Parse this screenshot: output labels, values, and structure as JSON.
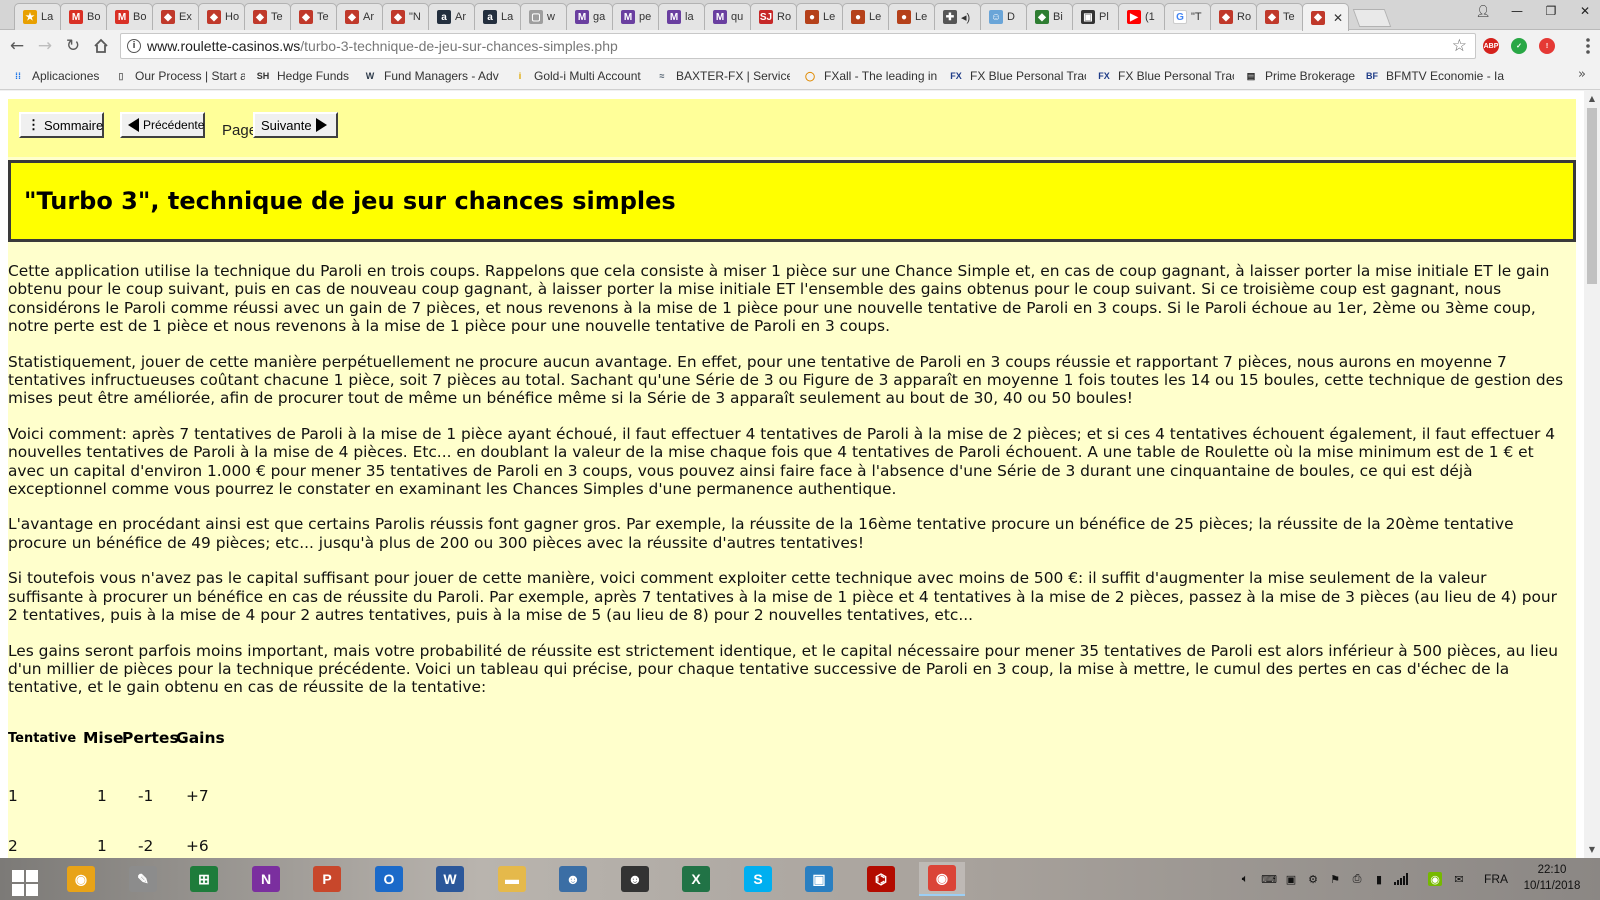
{
  "browser": {
    "tabs": [
      {
        "label": "La",
        "favicon_color": "#e8a000",
        "glyph": "★"
      },
      {
        "label": "Bo",
        "favicon_color": "#d93025",
        "glyph": "M"
      },
      {
        "label": "Bo",
        "favicon_color": "#d93025",
        "glyph": "M"
      },
      {
        "label": "Ex",
        "favicon_color": "#c0392b",
        "glyph": "◆"
      },
      {
        "label": "Ho",
        "favicon_color": "#c0392b",
        "glyph": "◆"
      },
      {
        "label": "Te",
        "favicon_color": "#c0392b",
        "glyph": "◆"
      },
      {
        "label": "Te",
        "favicon_color": "#c0392b",
        "glyph": "◆"
      },
      {
        "label": "Ar",
        "favicon_color": "#c0392b",
        "glyph": "◆"
      },
      {
        "label": "\"N",
        "favicon_color": "#c0392b",
        "glyph": "◆"
      },
      {
        "label": "Ar",
        "favicon_color": "#232f3e",
        "glyph": "a"
      },
      {
        "label": "La",
        "favicon_color": "#232f3e",
        "glyph": "a"
      },
      {
        "label": "w",
        "favicon_color": "#9e9e9e",
        "glyph": "▢"
      },
      {
        "label": "ga",
        "favicon_color": "#6a3fa0",
        "glyph": "M"
      },
      {
        "label": "pe",
        "favicon_color": "#6a3fa0",
        "glyph": "M"
      },
      {
        "label": "la",
        "favicon_color": "#6a3fa0",
        "glyph": "M"
      },
      {
        "label": "qu",
        "favicon_color": "#6a3fa0",
        "glyph": "M"
      },
      {
        "label": "Ro",
        "favicon_color": "#c62828",
        "glyph": "SJ"
      },
      {
        "label": "Le",
        "favicon_color": "#b5411a",
        "glyph": "●"
      },
      {
        "label": "Le",
        "favicon_color": "#b5411a",
        "glyph": "●"
      },
      {
        "label": "Le",
        "favicon_color": "#b5411a",
        "glyph": "●"
      },
      {
        "label": "◂)",
        "favicon_color": "#555555",
        "glyph": "✚"
      },
      {
        "label": "D",
        "favicon_color": "#6aa5d8",
        "glyph": "☺"
      },
      {
        "label": "Bi",
        "favicon_color": "#2e7d32",
        "glyph": "◆"
      },
      {
        "label": "Pl",
        "favicon_color": "#333333",
        "glyph": "▣"
      },
      {
        "label": "(1",
        "favicon_color": "#ff0000",
        "glyph": "▶"
      },
      {
        "label": "\"T",
        "favicon_color": "#ffffff",
        "glyph": "G"
      },
      {
        "label": "Ro",
        "favicon_color": "#c0392b",
        "glyph": "◆"
      },
      {
        "label": "Te",
        "favicon_color": "#c0392b",
        "glyph": "◆"
      },
      {
        "label": "",
        "favicon_color": "#c0392b",
        "glyph": "◆",
        "active": true
      }
    ],
    "url_domain": "www.roulette-casinos.ws",
    "url_path": "/turbo-3-technique-de-jeu-sur-chances-simples.php",
    "bookmarks": [
      {
        "label": "Aplicaciones",
        "icon": "apps-grid"
      },
      {
        "label": "Our Process | Start a",
        "icon": "page"
      },
      {
        "label": "Hedge Funds",
        "icon": "SH"
      },
      {
        "label": "Fund Managers - Adv",
        "icon": "W"
      },
      {
        "label": "Gold-i Multi Account",
        "icon": "i"
      },
      {
        "label": "BAXTER-FX | Services",
        "icon": "wave"
      },
      {
        "label": "FXall - The leading in",
        "icon": "circle"
      },
      {
        "label": "FX Blue Personal Trac",
        "icon": "FX"
      },
      {
        "label": "FX Blue Personal Trac",
        "icon": "FX"
      },
      {
        "label": "Prime Brokerage",
        "icon": "keyboard"
      },
      {
        "label": "BFMTV Economie - Ia",
        "icon": "BF"
      }
    ],
    "extensions": [
      {
        "name": "adblock-plus",
        "label": "ABP",
        "color": "#d5221d"
      },
      {
        "name": "check-extension",
        "label": "✓",
        "color": "#29a745"
      },
      {
        "name": "alert-extension",
        "label": "!",
        "color": "#e53935"
      }
    ]
  },
  "page": {
    "nav": {
      "sommaire": "Sommaire",
      "precedente": "Précédente",
      "page_word": "Page",
      "suivante": "Suivante"
    },
    "title": "\"Turbo 3\", technique de jeu sur chances simples",
    "paragraphs": [
      "Cette application utilise la technique du Paroli en trois coups. Rappelons que cela consiste à miser 1 pièce sur une Chance Simple et, en cas de coup gagnant, à laisser porter la mise initiale ET le gain obtenu pour le coup suivant, puis en cas de nouveau coup gagnant, à laisser porter la mise initiale ET l'ensemble des gains obtenus pour le coup suivant. Si ce troisième coup est gagnant, nous considérons le Paroli comme réussi avec un gain de 7 pièces, et nous revenons à la mise de 1 pièce pour une nouvelle tentative de Paroli en 3 coups. Si le Paroli échoue au 1er, 2ème ou 3ème coup, notre perte est de 1 pièce et nous revenons à la mise de 1 pièce pour une nouvelle tentative de Paroli en 3 coups.",
      "Statistiquement, jouer de cette manière perpétuellement ne procure aucun avantage. En effet, pour une tentative de Paroli en 3 coups réussie et rapportant 7 pièces, nous aurons en moyenne 7 tentatives infructueuses coûtant chacune 1 pièce, soit 7 pièces au total. Sachant qu'une Série de 3 ou Figure de 3 apparaît en moyenne 1 fois toutes les 14 ou 15 boules, cette technique de gestion des mises peut être améliorée, afin de procurer tout de même un bénéfice même si la Série de 3 apparaît seulement au bout de 30, 40 ou 50 boules!",
      "Voici comment: après 7 tentatives de Paroli à la mise de 1 pièce ayant échoué, il faut effectuer 4 tentatives de Paroli à la mise de 2 pièces; et si ces 4 tentatives échouent également, il faut effectuer 4 nouvelles tentatives de Paroli à la mise de 4 pièces. Etc... en doublant la valeur de la mise chaque fois que 4 tentatives de Paroli échouent. A une table de Roulette où la mise minimum est de 1 € et avec un capital d'environ 1.000 € pour mener 35 tentatives de Paroli en 3 coups, vous pouvez ainsi faire face à l'absence d'une Série de 3 durant une cinquantaine de boules, ce qui est déjà exceptionnel comme vous pourrez le constater en examinant les Chances Simples d'une permanence authentique.",
      "L'avantage en procédant ainsi est que certains Parolis réussis font gagner gros. Par exemple, la réussite de la 16ème tentative procure un bénéfice de 25 pièces; la réussite de la 20ème tentative procure un bénéfice de 49 pièces; etc... jusqu'à plus de 200 ou 300 pièces avec la réussite d'autres tentatives!",
      "Si toutefois vous n'avez pas le capital suffisant pour jouer de cette manière, voici comment exploiter cette technique avec moins de 500 €: il suffit d'augmenter la mise seulement de la valeur suffisante à procurer un bénéfice en cas de réussite du Paroli. Par exemple, après 7 tentatives à la mise de 1 pièce et 4 tentatives à la mise de 2 pièces, passez à la mise de 3 pièces (au lieu de 4) pour 2 tentatives, puis à la mise de 4 pour 2 autres tentatives, puis à la mise de 5 (au lieu de 8) pour 2 nouvelles tentatives, etc...",
      "Les gains seront parfois moins important, mais votre probabilité de réussite est strictement identique, et le capital nécessaire pour mener 35 tentatives de Paroli est alors inférieur à 500 pièces, au lieu d'un millier de pièces pour la technique précédente. Voici un tableau qui précise, pour chaque tentative successive de Paroli en 3 coup, la mise à mettre, le cumul des pertes en cas d'échec de la tentative, et le gain obtenu en cas de réussite de la tentative:"
    ],
    "table": {
      "headers": [
        "Tentative",
        "Mise",
        "Pertes",
        "Gains"
      ],
      "rows": [
        [
          "1",
          "1",
          "-1",
          "+7"
        ],
        [
          "2",
          "1",
          "-2",
          "+6"
        ]
      ]
    }
  },
  "taskbar": {
    "apps": [
      {
        "name": "picasa",
        "label": "◉",
        "color": "#e8a317"
      },
      {
        "name": "notepad-app",
        "label": "✎",
        "color": "#8c8c8c"
      },
      {
        "name": "excel-green",
        "label": "⊞",
        "color": "#1e7c3b"
      },
      {
        "name": "onenote",
        "label": "N",
        "color": "#7b2f9f"
      },
      {
        "name": "powerpoint",
        "label": "P",
        "color": "#c8472b"
      },
      {
        "name": "outlook",
        "label": "O",
        "color": "#1b6ac9"
      },
      {
        "name": "word",
        "label": "W",
        "color": "#2b579a"
      },
      {
        "name": "file-explorer",
        "label": "▬",
        "color": "#e5b94b"
      },
      {
        "name": "owl-app-blue",
        "label": "☻",
        "color": "#3b6ea5"
      },
      {
        "name": "owl-app-dark",
        "label": "☻",
        "color": "#333333"
      },
      {
        "name": "excel",
        "label": "X",
        "color": "#217346"
      },
      {
        "name": "skype",
        "label": "S",
        "color": "#00aff0"
      },
      {
        "name": "network-app",
        "label": "▣",
        "color": "#2a7fc1"
      },
      {
        "name": "acrobat",
        "label": "⌬",
        "color": "#b30b00"
      },
      {
        "name": "chrome",
        "label": "◉",
        "color": "#db4437",
        "active": true
      }
    ],
    "language": "FRA",
    "time": "22:10",
    "date": "10/11/2018"
  }
}
